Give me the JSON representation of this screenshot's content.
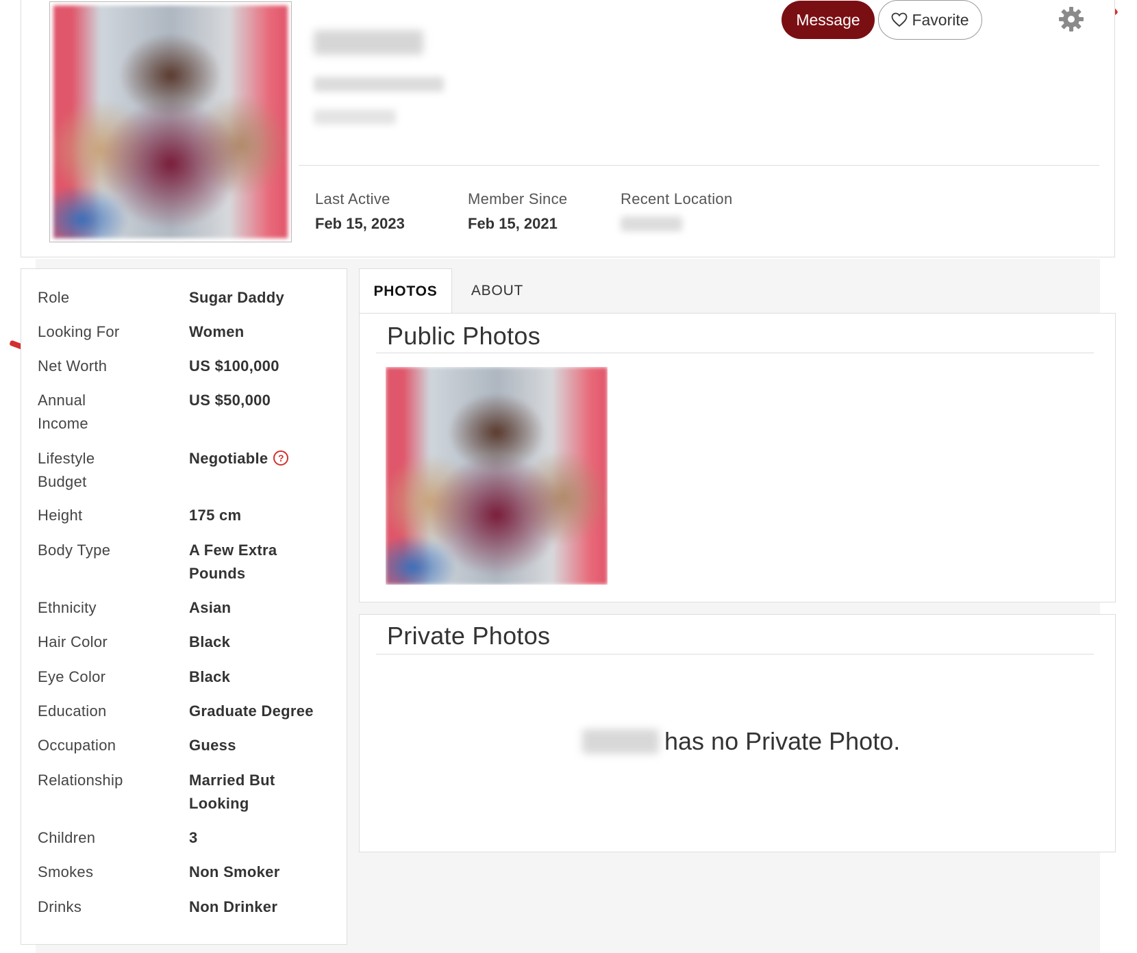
{
  "header": {
    "message_label": "Message",
    "favorite_label": "Favorite",
    "stats": [
      {
        "label": "Last Active",
        "value": "Feb 15, 2023"
      },
      {
        "label": "Member Since",
        "value": "Feb 15, 2021"
      },
      {
        "label": "Recent Location",
        "value": ""
      }
    ]
  },
  "attributes": [
    {
      "key": "Role",
      "value": "Sugar Daddy"
    },
    {
      "key": "Looking For",
      "value": "Women"
    },
    {
      "key": "Net Worth",
      "value": "US $100,000"
    },
    {
      "key": "Annual Income",
      "value": "US $50,000"
    },
    {
      "key": "Lifestyle Budget",
      "value": "Negotiable"
    },
    {
      "key": "Height",
      "value": "175 cm"
    },
    {
      "key": "Body Type",
      "value": "A Few Extra Pounds"
    },
    {
      "key": "Ethnicity",
      "value": "Asian"
    },
    {
      "key": "Hair Color",
      "value": "Black"
    },
    {
      "key": "Eye Color",
      "value": "Black"
    },
    {
      "key": "Education",
      "value": "Graduate Degree"
    },
    {
      "key": "Occupation",
      "value": "Guess"
    },
    {
      "key": "Relationship",
      "value": "Married But Looking"
    },
    {
      "key": "Children",
      "value": "3"
    },
    {
      "key": "Smokes",
      "value": "Non Smoker"
    },
    {
      "key": "Drinks",
      "value": "Non Drinker"
    }
  ],
  "tabs": [
    {
      "label": "PHOTOS",
      "active": true
    },
    {
      "label": "ABOUT",
      "active": false
    }
  ],
  "public_photos": {
    "title": "Public Photos"
  },
  "private_photos": {
    "title": "Private Photos",
    "empty_message": "has no Private Photo."
  },
  "colors": {
    "accent": "#7a0f13",
    "help": "#d32f2f",
    "panel_bg": "#f5f5f5"
  }
}
